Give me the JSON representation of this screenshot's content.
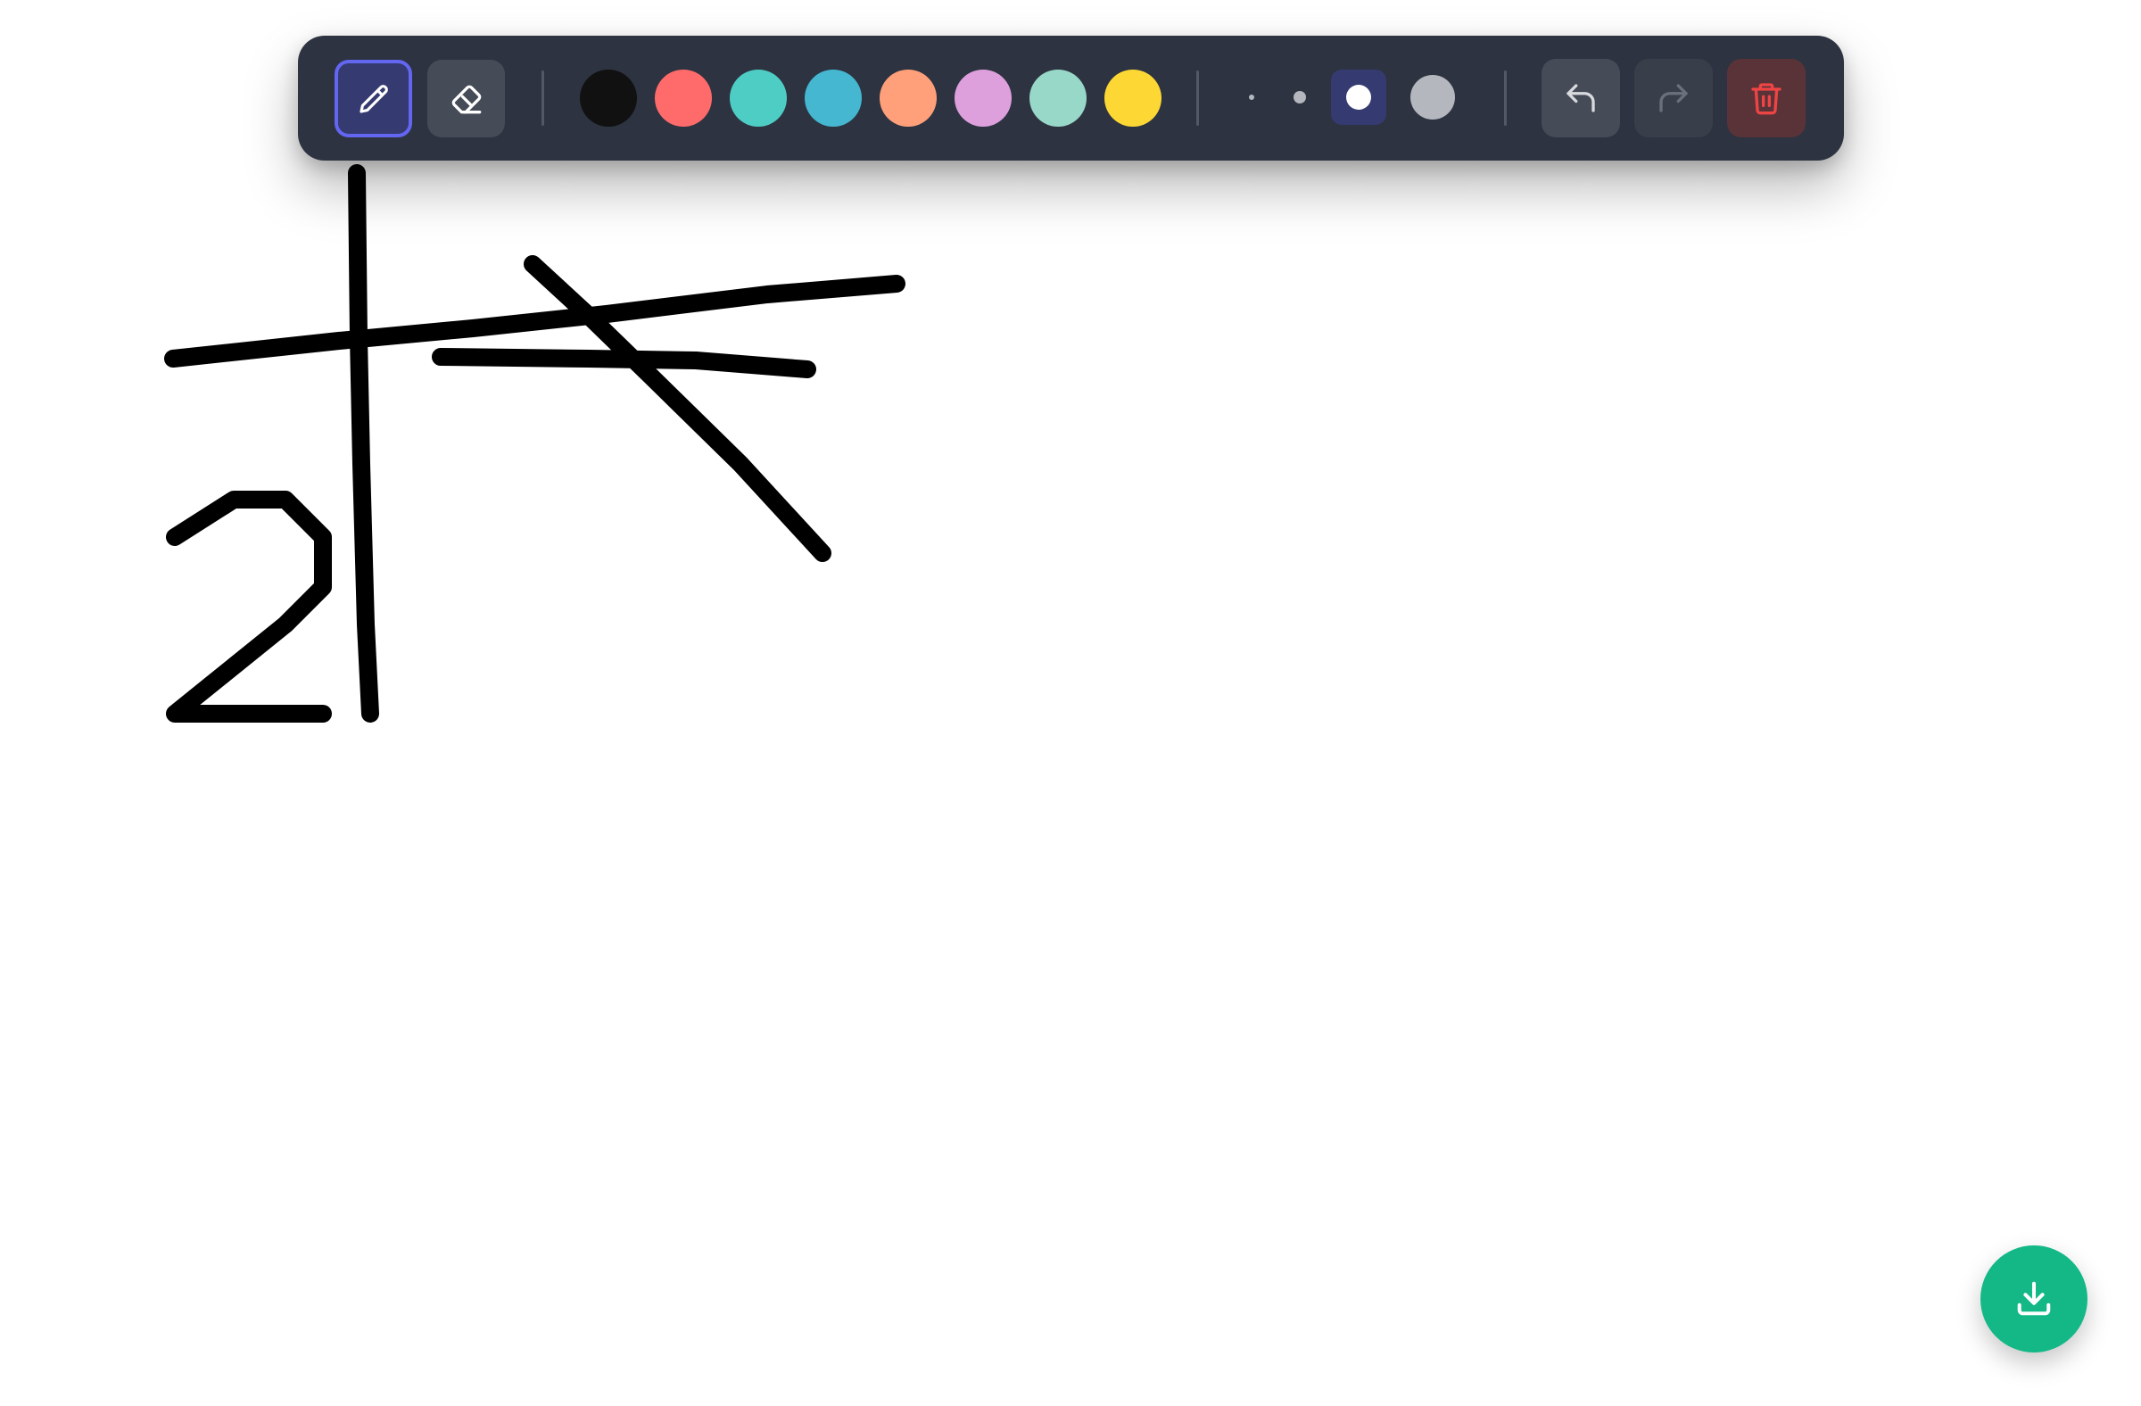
{
  "toolbar": {
    "tools": [
      {
        "name": "pen",
        "icon": "pencil-icon",
        "active": true
      },
      {
        "name": "eraser",
        "icon": "eraser-icon",
        "active": false
      }
    ],
    "colors": [
      "#111111",
      "#ff6b6b",
      "#4ecdc4",
      "#45b7d1",
      "#ffa07a",
      "#dda0dd",
      "#98d8c8",
      "#fdd835"
    ],
    "selected_color": "#111111",
    "brush_sizes": [
      "extra-small",
      "small",
      "medium",
      "large"
    ],
    "selected_brush_size": "medium",
    "history": [
      {
        "name": "undo",
        "icon": "undo-icon",
        "enabled": true
      },
      {
        "name": "redo",
        "icon": "redo-icon",
        "enabled": false
      },
      {
        "name": "clear",
        "icon": "trash-icon",
        "enabled": true
      }
    ],
    "accent_color": "#6366f1",
    "danger_color": "#ef4444"
  },
  "canvas": {
    "background": "#ffffff",
    "stroke_color": "#000000"
  },
  "download": {
    "icon": "download-icon",
    "color": "#13b886"
  }
}
